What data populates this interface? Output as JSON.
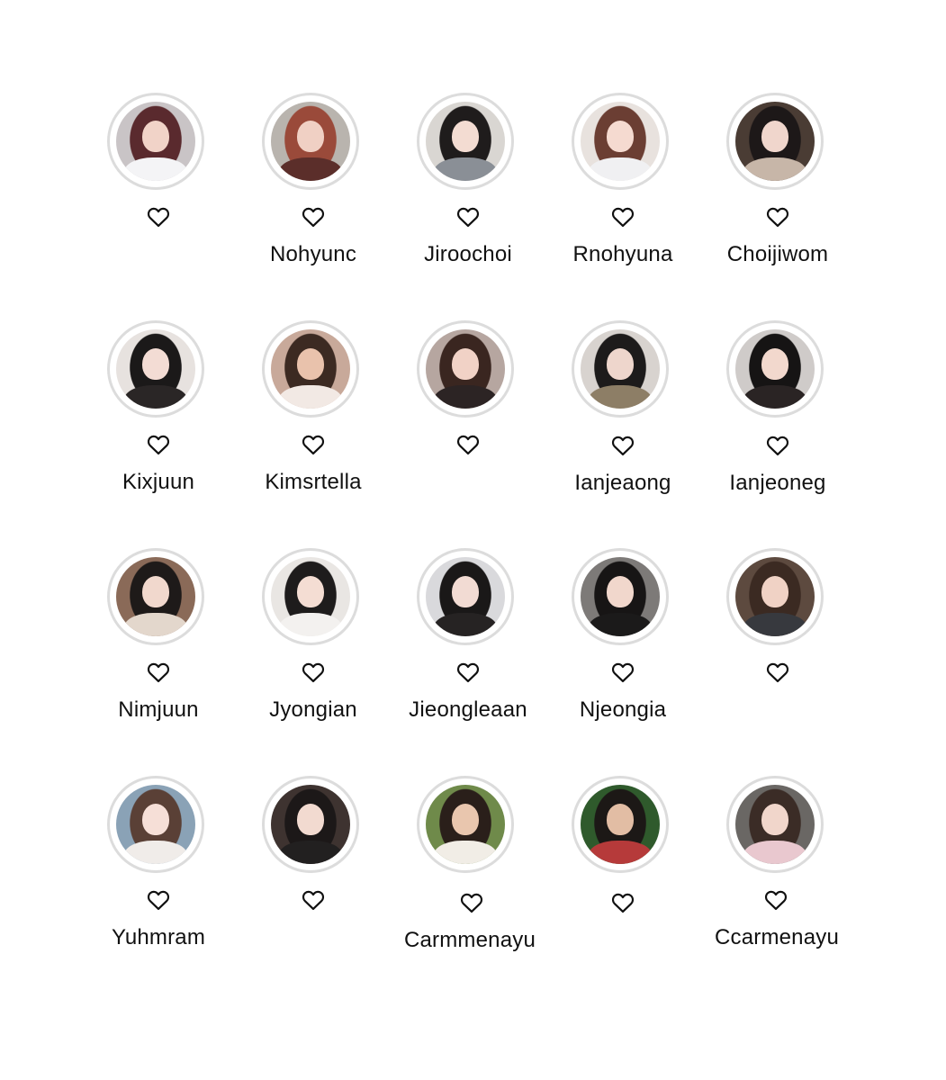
{
  "profiles": [
    {
      "name": "",
      "avatar": {
        "bg": "#c9c4c6",
        "hair": "#5a2a2e",
        "skin": "#f1d3c8",
        "outfit": "#f4f4f6"
      }
    },
    {
      "name": "Nohyunc",
      "avatar": {
        "bg": "#b9b4ae",
        "hair": "#9a4a3a",
        "skin": "#f0d0c4",
        "outfit": "#5b2e2a"
      }
    },
    {
      "name": "Jiroochoi",
      "avatar": {
        "bg": "#d9d6d2",
        "hair": "#1f1c1c",
        "skin": "#f3dcd2",
        "outfit": "#8a8f96"
      }
    },
    {
      "name": "Rnohyuna",
      "avatar": {
        "bg": "#e8e2de",
        "hair": "#6b3e33",
        "skin": "#f5dad0",
        "outfit": "#f0f0f2"
      }
    },
    {
      "name": "Choijiwom",
      "avatar": {
        "bg": "#4a3c34",
        "hair": "#1d1818",
        "skin": "#f0d6cc",
        "outfit": "#c7b6a8"
      }
    },
    {
      "name": "Kixjuun",
      "avatar": {
        "bg": "#e7e2df",
        "hair": "#1b1919",
        "skin": "#f3dcd4",
        "outfit": "#2a2626"
      }
    },
    {
      "name": "Kimsrtella",
      "avatar": {
        "bg": "#c8a99a",
        "hair": "#3c2a22",
        "skin": "#e9c2ac",
        "outfit": "#f2e9e4"
      }
    },
    {
      "name": "",
      "avatar": {
        "bg": "#b6a6a0",
        "hair": "#3a2620",
        "skin": "#f1d2c6",
        "outfit": "#2c2424"
      }
    },
    {
      "name": "Ianjeaong",
      "avatar": {
        "bg": "#d8d3cf",
        "hair": "#1d1b1b",
        "skin": "#eed6cc",
        "outfit": "#8d7e66"
      }
    },
    {
      "name": "Ianjeoneg",
      "avatar": {
        "bg": "#cfcbc9",
        "hair": "#161414",
        "skin": "#f2d8cd",
        "outfit": "#2a2424"
      }
    },
    {
      "name": "Nimjuun",
      "avatar": {
        "bg": "#8a6a58",
        "hair": "#1e1a19",
        "skin": "#f1d8cd",
        "outfit": "#e3d7cc"
      }
    },
    {
      "name": "Jyongian",
      "avatar": {
        "bg": "#e9e6e3",
        "hair": "#1e1c1c",
        "skin": "#f4ddd3",
        "outfit": "#f3f1ef"
      }
    },
    {
      "name": "Jieongleaan",
      "avatar": {
        "bg": "#d9d9dc",
        "hair": "#1a1818",
        "skin": "#f2dbd3",
        "outfit": "#262323"
      }
    },
    {
      "name": "Njeongia",
      "avatar": {
        "bg": "#7d7a78",
        "hair": "#171515",
        "skin": "#f1d7cc",
        "outfit": "#1b1a1a"
      }
    },
    {
      "name": "",
      "avatar": {
        "bg": "#5d4a3f",
        "hair": "#3b2a22",
        "skin": "#f0d2c5",
        "outfit": "#37393e"
      }
    },
    {
      "name": "Yuhmram",
      "avatar": {
        "bg": "#8aa2b6",
        "hair": "#5a4036",
        "skin": "#f6dfd7",
        "outfit": "#f0ece9"
      }
    },
    {
      "name": "",
      "avatar": {
        "bg": "#3e3330",
        "hair": "#1c1818",
        "skin": "#f2dad0",
        "outfit": "#222020"
      }
    },
    {
      "name": "Carmmenayu",
      "avatar": {
        "bg": "#6f8a4a",
        "hair": "#2a1f1a",
        "skin": "#e9c6ae",
        "outfit": "#f1ede6"
      }
    },
    {
      "name": "",
      "avatar": {
        "bg": "#2f5a2c",
        "hair": "#1c1816",
        "skin": "#e2bda4",
        "outfit": "#b63a3a"
      }
    },
    {
      "name": "Ccarmenayu",
      "avatar": {
        "bg": "#6a6764",
        "hair": "#3b2c26",
        "skin": "#f1d6cb",
        "outfit": "#e9c8cf"
      }
    }
  ],
  "icons": {
    "like": "heart-outline-icon"
  },
  "colors": {
    "ring": "#dcdcdc",
    "text": "#111111",
    "background": "#ffffff"
  }
}
